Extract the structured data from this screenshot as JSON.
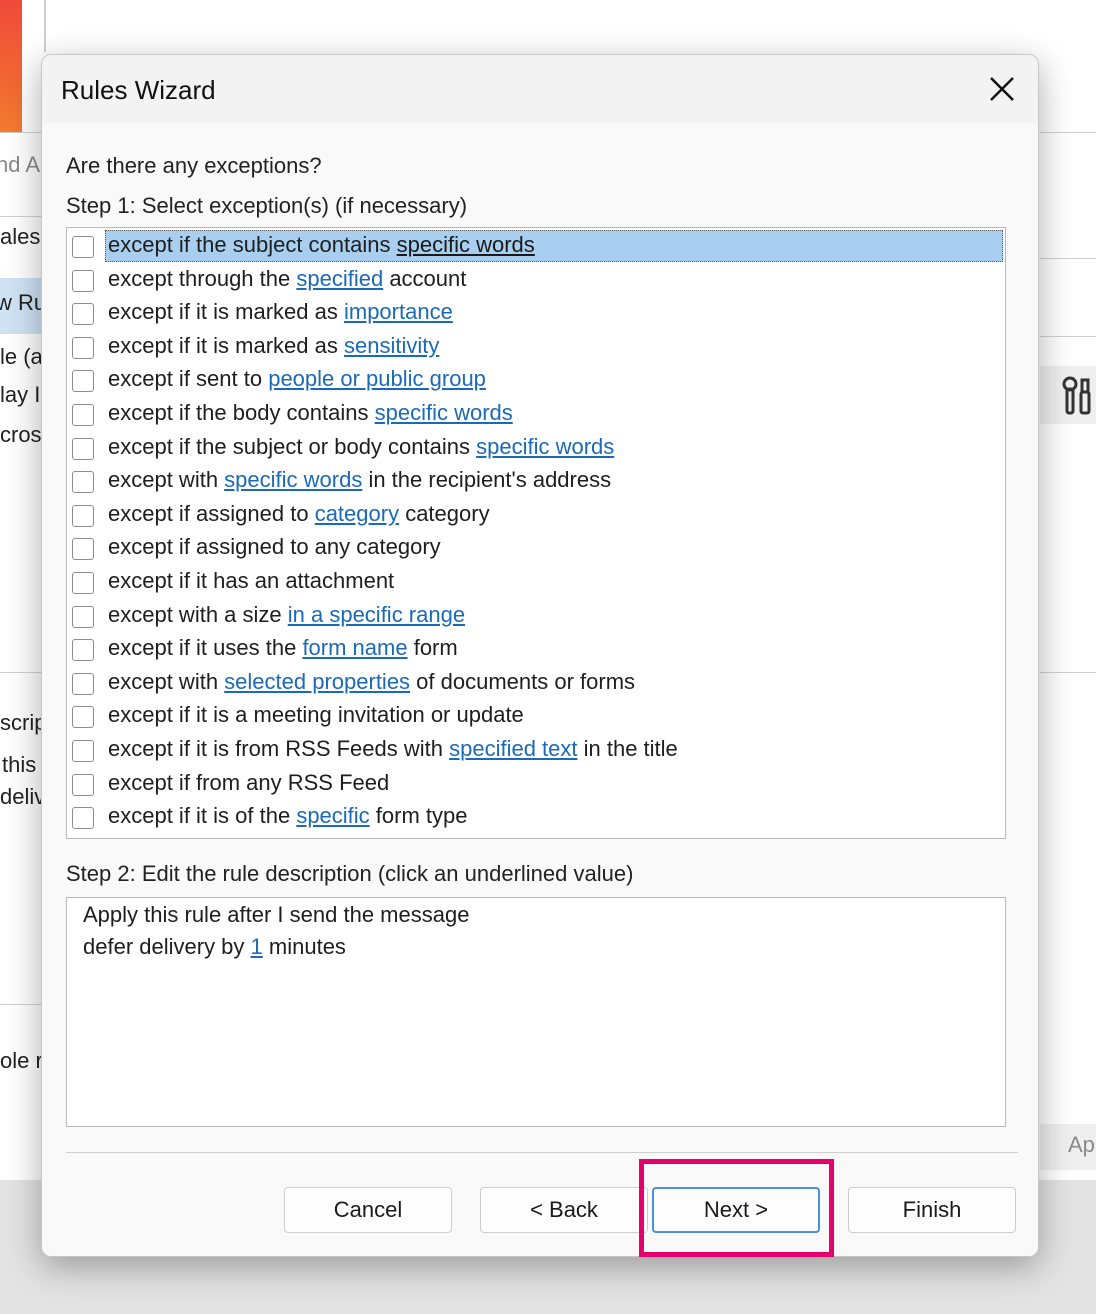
{
  "background": {
    "fragments": [
      "nd A",
      "ales",
      "w Ru",
      "le (a",
      "lay I",
      "cros",
      "scrip",
      "this",
      "deliv",
      "ole r",
      "Ap"
    ]
  },
  "dialog": {
    "title": "Rules Wizard",
    "question": "Are there any exceptions?",
    "step1_label": "Step 1: Select exception(s) (if necessary)",
    "exceptions": [
      {
        "pre": "except if the subject contains ",
        "link": "specific words",
        "post": "",
        "checked": false,
        "selected": true
      },
      {
        "pre": "except through the ",
        "link": "specified",
        "post": " account",
        "checked": false
      },
      {
        "pre": "except if it is marked as ",
        "link": "importance",
        "post": "",
        "checked": false
      },
      {
        "pre": "except if it is marked as ",
        "link": "sensitivity",
        "post": "",
        "checked": false
      },
      {
        "pre": "except if sent to ",
        "link": "people or public group",
        "post": "",
        "checked": false
      },
      {
        "pre": "except if the body contains ",
        "link": "specific words",
        "post": "",
        "checked": false
      },
      {
        "pre": "except if the subject or body contains ",
        "link": "specific words",
        "post": "",
        "checked": false
      },
      {
        "pre": "except with ",
        "link": "specific words",
        "post": " in the recipient's address",
        "checked": false
      },
      {
        "pre": "except if assigned to ",
        "link": "category",
        "post": " category",
        "checked": false
      },
      {
        "pre": "except if assigned to any category",
        "link": "",
        "post": "",
        "checked": false
      },
      {
        "pre": "except if it has an attachment",
        "link": "",
        "post": "",
        "checked": false
      },
      {
        "pre": "except with a size ",
        "link": "in a specific range",
        "post": "",
        "checked": false
      },
      {
        "pre": "except if it uses the ",
        "link": "form name",
        "post": " form",
        "checked": false
      },
      {
        "pre": "except with ",
        "link": "selected properties",
        "post": " of documents or forms",
        "checked": false
      },
      {
        "pre": "except if it is a meeting invitation or update",
        "link": "",
        "post": "",
        "checked": false
      },
      {
        "pre": "except if it is from RSS Feeds with ",
        "link": "specified text",
        "post": " in the title",
        "checked": false
      },
      {
        "pre": "except if from any RSS Feed",
        "link": "",
        "post": "",
        "checked": false
      },
      {
        "pre": "except if it is of the ",
        "link": "specific",
        "post": " form type",
        "checked": false
      }
    ],
    "step2_label": "Step 2: Edit the rule description (click an underlined value)",
    "description": {
      "line1": "Apply this rule after I send the message",
      "line2_pre": "defer delivery by ",
      "line2_link": "1",
      "line2_post": " minutes"
    },
    "buttons": {
      "cancel": "Cancel",
      "back": "< Back",
      "next": "Next >",
      "finish": "Finish"
    }
  },
  "colors": {
    "link": "#1b6ab8",
    "selection": "#a8cff0",
    "highlight_box": "#e5006e",
    "primary_border": "#4a8fd8"
  }
}
